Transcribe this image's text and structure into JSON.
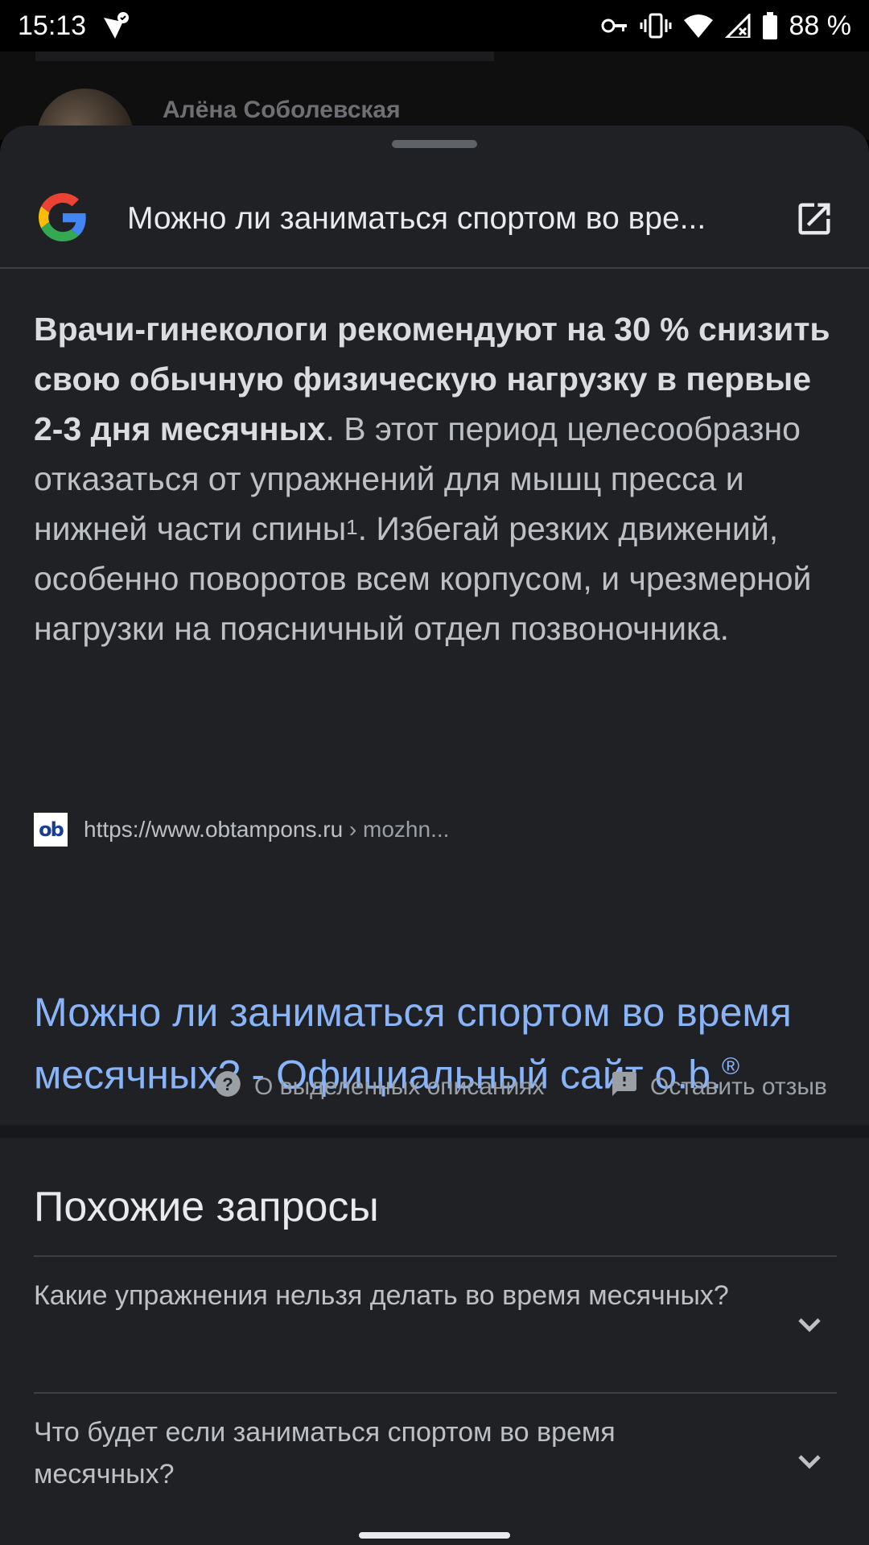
{
  "status_bar": {
    "time": "15:13",
    "battery": "88 %",
    "icons": [
      "vpn-checkmark-icon",
      "key-icon",
      "vibrate-icon",
      "wifi-icon",
      "signal-icon",
      "battery-icon"
    ]
  },
  "background": {
    "contact_name": "Алёна Соболевская"
  },
  "sheet": {
    "title": "Можно ли заниматься спортом во вре...",
    "logo": "google-g-logo",
    "open_icon": "open-in-new-icon"
  },
  "snippet": {
    "bold": "Врачи-гинекологи рекомендуют на 30 % снизить свою обычную физическую нагрузку в первые 2-3 дня месячных",
    "text_1": ". В этот период целесообразно отказаться от упражнений для мышц пресса и нижней части спины",
    "footnote": "1",
    "text_2": ". Избегай резких движений, особенно поворотов всем корпусом, и чрезмерной нагрузки на поясничный отдел позвоночника."
  },
  "source": {
    "favicon_text": "ob",
    "url": "https://www.obtampons.ru",
    "path": " › mozhn...",
    "link_title": "Можно ли заниматься спортом во время месячных? - Официальный сайт o.b.",
    "link_mark": "®"
  },
  "actions": {
    "about": "О выделенных описаниях",
    "feedback": "Оставить отзыв"
  },
  "related": {
    "title": "Похожие запросы",
    "items": [
      {
        "text": "Какие упражнения нельзя делать во время месячных?"
      },
      {
        "text": "Что будет если заниматься спортом во время месячных?"
      }
    ]
  },
  "colors": {
    "sheet_bg": "#202124",
    "link": "#8ab4f8",
    "text": "#bdc1c6"
  }
}
